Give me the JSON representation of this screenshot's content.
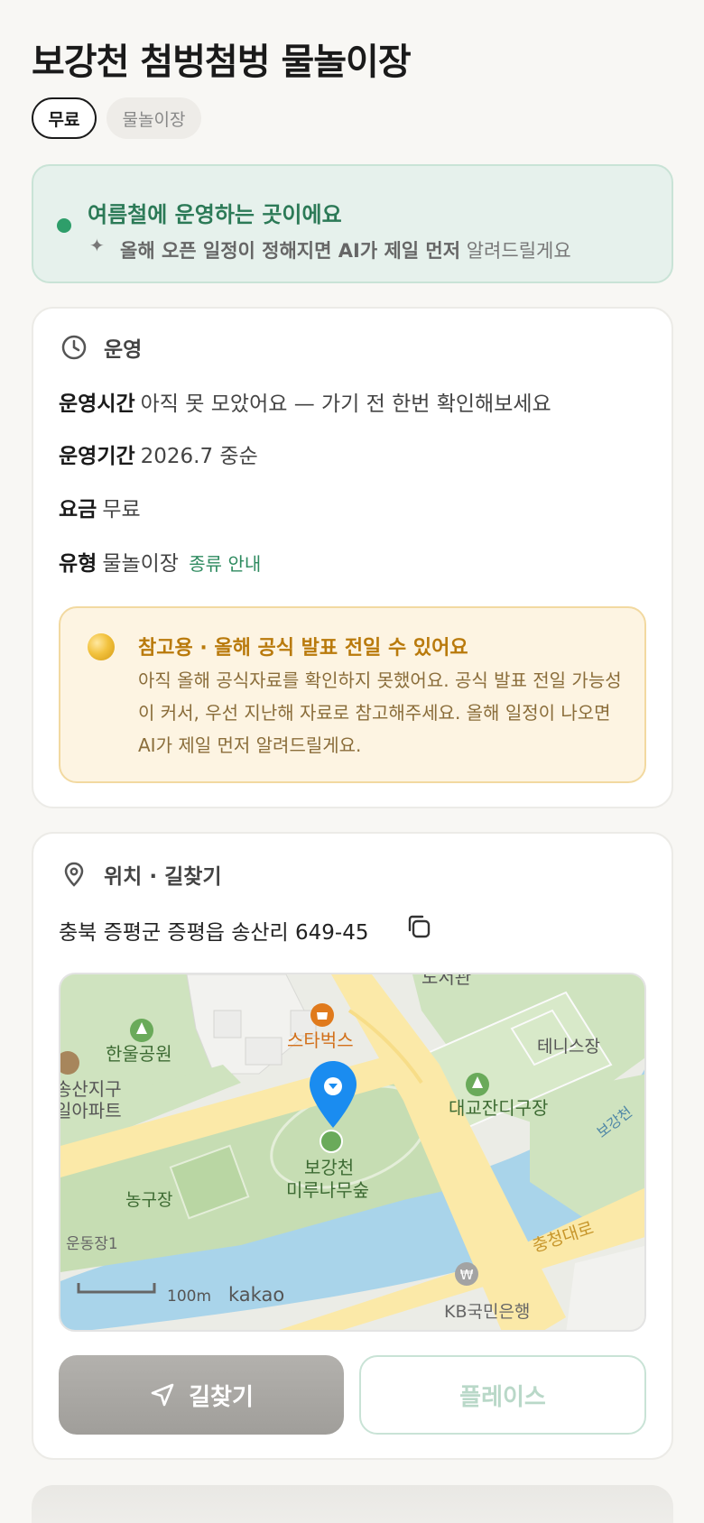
{
  "place": {
    "title": "보강천 첨벙첨벙 물놀이장",
    "chips": [
      "무료",
      "물놀이장"
    ]
  },
  "season_banner": {
    "title": "여름철에 운영하는 곳이에요",
    "sparkle": "✦",
    "subtitle_bold": "올해 오픈 일정이 정해지면 AI가 제일 먼저",
    "subtitle_rest": " 알려드릴게요"
  },
  "operation": {
    "heading": "운영",
    "rows": [
      {
        "key": "운영시간",
        "value": "아직 못 모았어요 — 가기 전 한번 확인해보세요"
      },
      {
        "key": "운영기간",
        "value": "2026.7 중순"
      },
      {
        "key": "요금",
        "value": "무료"
      },
      {
        "key": "유형",
        "value": "물놀이장",
        "link": "종류 안내"
      }
    ],
    "notice": {
      "title": "참고용 · 올해 공식 발표 전일 수 있어요",
      "body": "아직 올해 공식자료를 확인하지 못했어요. 공식 발표 전일 가능성이 커서, 우선 지난해 자료로 참고해주세요. 올해 일정이 나오면 AI가 제일 먼저 알려드릴게요."
    }
  },
  "location": {
    "heading": "위치 · 길찾기",
    "address": "충북 증평군 증평읍 송산리 649-45",
    "map": {
      "labels": {
        "top": "도서관",
        "park": "한울공원",
        "apt1": "송산지구",
        "apt2": "일아파트",
        "cafe": "스타벅스",
        "tennis": "테니스장",
        "grass": "대교잔디구장",
        "river": "보강천",
        "place1": "보강천",
        "place2": "미루나무숲",
        "basket": "농구장",
        "field": "운동장1",
        "road": "충청대로",
        "bank": "KB국민은행",
        "scale": "100m",
        "brand": "kakao"
      },
      "colors": {
        "pin": "#1a8cf0",
        "park": "#cfe3bf",
        "water": "#a9d4ea",
        "road": "#fbe9a8",
        "cafe": "#e07a1c"
      }
    },
    "buttons": {
      "directions": "길찾기",
      "place": "플레이스"
    }
  }
}
